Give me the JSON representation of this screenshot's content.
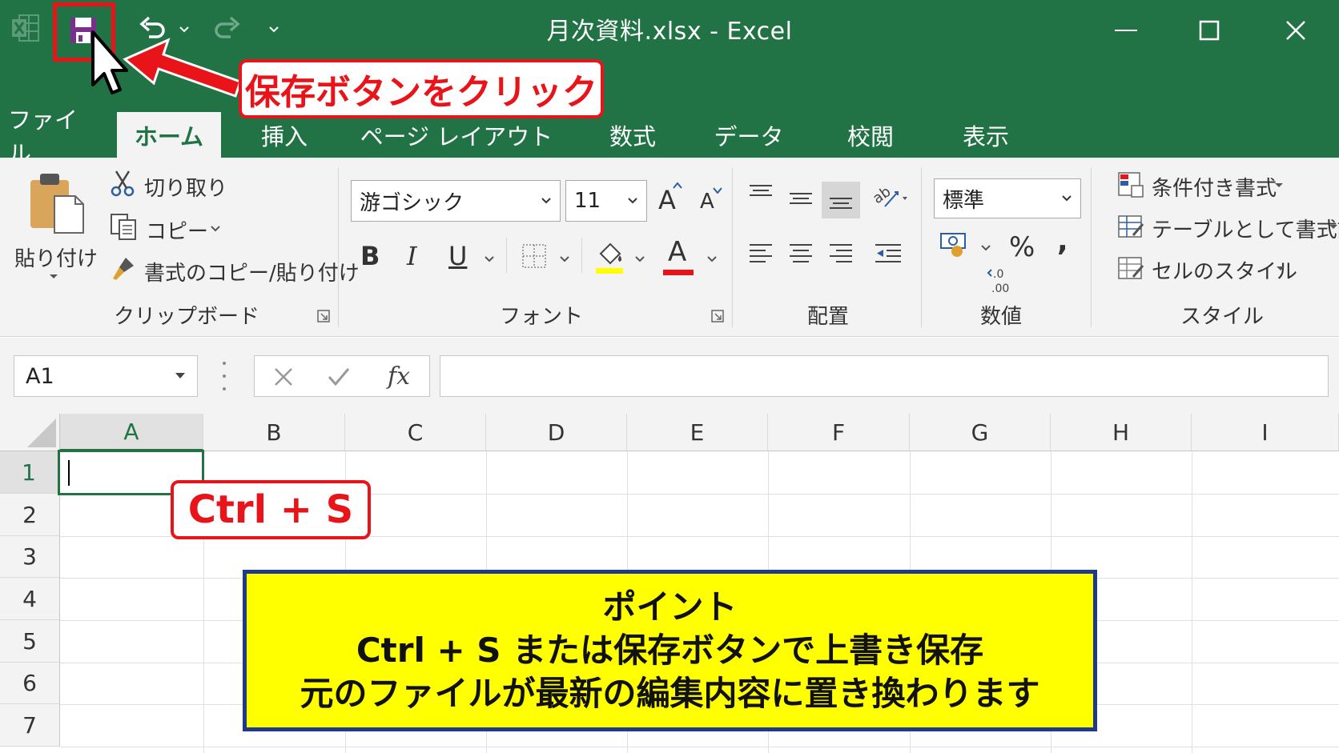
{
  "window": {
    "title": "月次資料.xlsx - Excel"
  },
  "quick_access": {
    "icons": [
      "excel-logo-icon",
      "save-icon",
      "undo-icon",
      "redo-icon",
      "customize-icon"
    ]
  },
  "tabs": [
    {
      "label": "ファイル"
    },
    {
      "label": "ホーム",
      "active": true
    },
    {
      "label": "挿入"
    },
    {
      "label": "ページ レイアウト"
    },
    {
      "label": "数式"
    },
    {
      "label": "データ"
    },
    {
      "label": "校閲"
    },
    {
      "label": "表示"
    }
  ],
  "ribbon": {
    "clipboard": {
      "paste_label": "貼り付け",
      "cut_label": "切り取り",
      "copy_label": "コピー",
      "format_painter_label": "書式のコピー/貼り付け",
      "group_label": "クリップボード"
    },
    "font": {
      "font_name": "游ゴシック",
      "font_size": "11",
      "grow_label": "A",
      "shrink_label": "A",
      "bold_label": "B",
      "italic_label": "I",
      "underline_label": "U",
      "font_color_label": "A",
      "group_label": "フォント",
      "highlight_color": "#ffff00",
      "font_color": "#e8141a"
    },
    "alignment": {
      "group_label": "配置"
    },
    "number": {
      "format": "標準",
      "percent_label": "%",
      "comma_label": ",",
      "group_label": "数値"
    },
    "styles": {
      "conditional_label": "条件付き書式",
      "table_label": "テーブルとして書式設定",
      "cell_styles_label": "セルのスタイル",
      "group_label": "スタイル"
    }
  },
  "formula_bar": {
    "name_box": "A1",
    "fx_label": "fx",
    "formula": ""
  },
  "grid": {
    "columns": [
      "A",
      "B",
      "C",
      "D",
      "E",
      "F",
      "G",
      "H",
      "I"
    ],
    "rows": [
      "1",
      "2",
      "3",
      "4",
      "5",
      "6",
      "7"
    ],
    "active_cell": "A1"
  },
  "annotations": {
    "save_callout": "保存ボタンをクリック",
    "shortcut_callout": "Ctrl + S",
    "point_title": "ポイント",
    "point_line1": "Ctrl + S または保存ボタンで上書き保存",
    "point_line2": "元のファイルが最新の編集内容に置き換わります"
  },
  "colors": {
    "excel_green": "#217346",
    "callout_red": "#e8141a",
    "point_bg": "#ffff00",
    "point_border": "#1f3a8a"
  }
}
